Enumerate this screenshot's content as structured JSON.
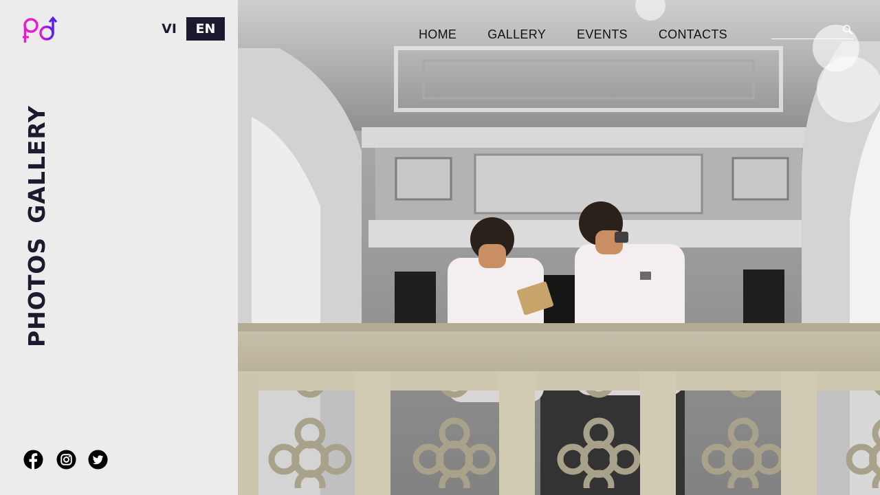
{
  "brand": {
    "logo_icon": "pd-gender-logo-icon",
    "colors": {
      "magenta": "#e61ccf",
      "purple": "#5b1cf0",
      "dark": "#1c1a2e"
    }
  },
  "language": {
    "vi": "VI",
    "en": "EN",
    "active": "EN"
  },
  "sidebar": {
    "title_word_1": "PHOTOS",
    "title_word_2": "GALLERY"
  },
  "social": [
    {
      "icon": "facebook-icon"
    },
    {
      "icon": "instagram-icon"
    },
    {
      "icon": "twitter-icon"
    }
  ],
  "nav": {
    "home": "HOME",
    "gallery": "GALLERY",
    "events": "EVENTS",
    "contacts": "CONTACTS"
  },
  "search": {
    "placeholder": "",
    "icon": "search-icon"
  }
}
